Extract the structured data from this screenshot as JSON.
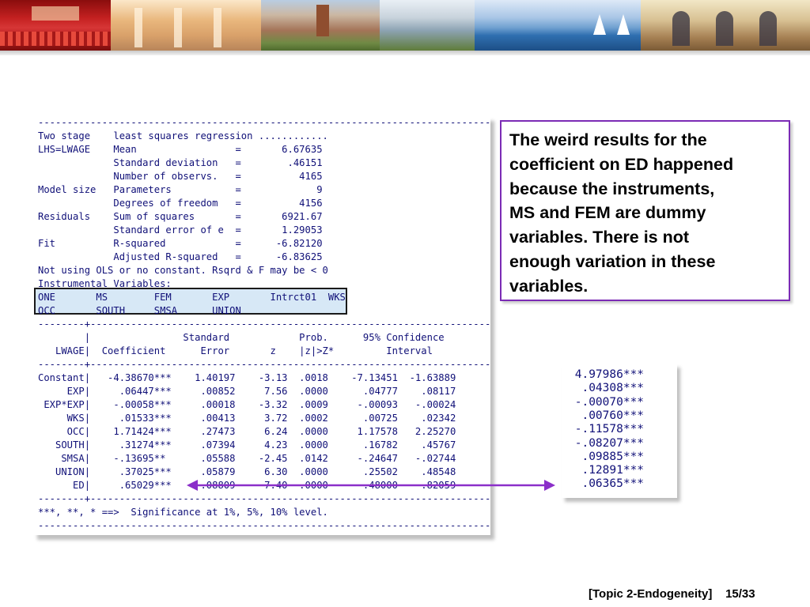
{
  "regression_output": {
    "lines": [
      "------------------------------------------------------------------------------",
      "Two stage    least squares regression ............",
      "LHS=LWAGE    Mean                 =       6.67635",
      "             Standard deviation   =        .46151",
      "             Number of observs.   =          4165",
      "Model size   Parameters           =             9",
      "             Degrees of freedom   =          4156",
      "Residuals    Sum of squares       =       6921.67",
      "             Standard error of e  =       1.29053",
      "Fit          R-squared            =      -6.82120",
      "             Adjusted R-squared   =      -6.83625",
      "Not using OLS or no constant. Rsqrd & F may be < 0",
      "Instrumental Variables:",
      "ONE       MS        FEM       EXP       Intrct01  WKS",
      "OCC       SOUTH     SMSA      UNION",
      "--------+---------------------------------------------------------------------",
      "        |                Standard            Prob.      95% Confidence",
      "   LWAGE|  Coefficient      Error       z    |z|>Z*         Interval",
      "--------+---------------------------------------------------------------------",
      "Constant|   -4.38670***    1.40197    -3.13  .0018    -7.13451  -1.63889",
      "     EXP|     .06447***     .00852     7.56  .0000      .04777    .08117",
      " EXP*EXP|    -.00058***     .00018    -3.32  .0009     -.00093   -.00024",
      "     WKS|     .01533***     .00413     3.72  .0002      .00725    .02342",
      "     OCC|    1.71424***     .27473     6.24  .0000     1.17578   2.25270",
      "   SOUTH|     .31274***     .07394     4.23  .0000      .16782    .45767",
      "    SMSA|    -.13695**      .05588    -2.45  .0142     -.24647   -.02744",
      "   UNION|     .37025***     .05879     6.30  .0000      .25502    .48548",
      "      ED|     .65029***     .08809     7.40  .0000      .48000    .82059",
      "--------+---------------------------------------------------------------------",
      "***, **, * ==>  Significance at 1%, 5%, 10% level.",
      "------------------------------------------------------------------------------"
    ]
  },
  "callout": {
    "lines": [
      "The weird results for the",
      "coefficient on ED happened",
      "because the instruments,",
      "MS and FEM are dummy",
      "variables.  There is not",
      "enough variation in these",
      "variables."
    ]
  },
  "ols_coefficients": [
    " 4.97986***",
    "  .04308***",
    " -.00070***",
    "  .00760***",
    " -.11578***",
    " -.08207***",
    "  .09885***",
    "  .12891***",
    "  .06365***"
  ],
  "footer": {
    "topic": "[Topic 2-Endogeneity]",
    "page": "15/33"
  },
  "colors": {
    "output_text": "#101078",
    "instrument_highlight": "#d7e8f6",
    "callout_border": "#7b2bb5",
    "arrow": "#8b2fc9"
  }
}
